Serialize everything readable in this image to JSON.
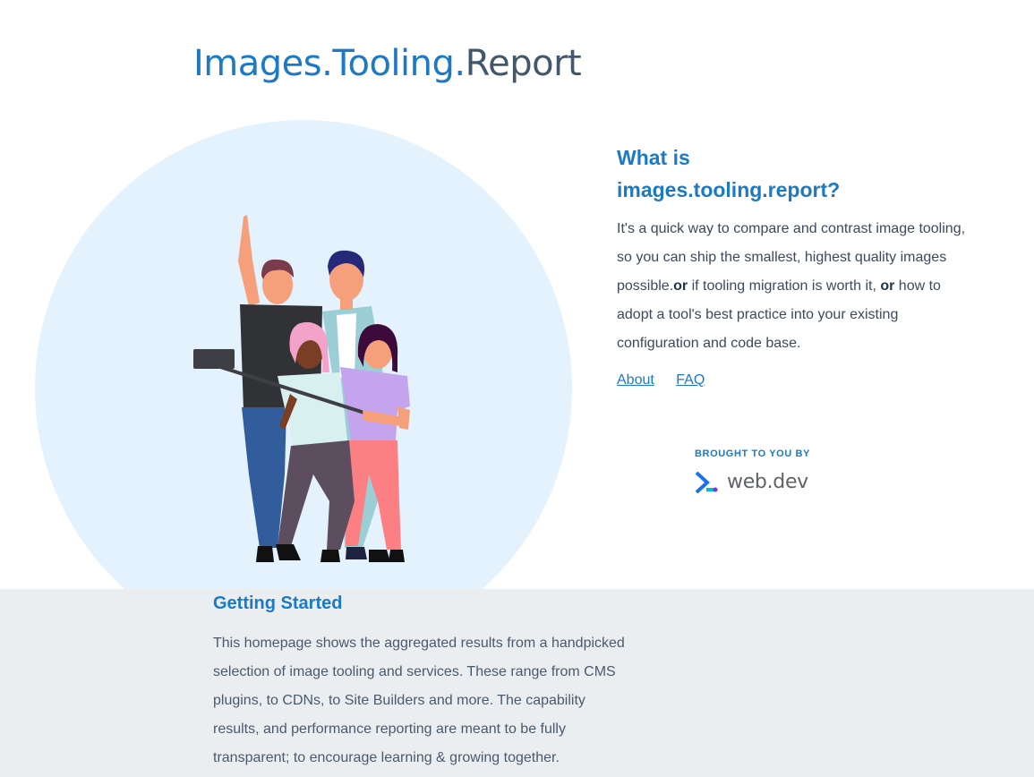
{
  "header": {
    "title_part1": "Images.",
    "title_part2": "Tooling.",
    "title_part3": "Report"
  },
  "intro": {
    "heading_line1": "What is",
    "heading_line2": "images.tooling.report?",
    "desc_1": "It's a quick way to compare and contrast image tooling, so you can ship the smallest, highest quality images possible.",
    "or_1": "or",
    "desc_2": " if tooling migration is worth it, ",
    "or_2": "or",
    "desc_3": " how to adopt a tool's best practice into your existing configuration and code base."
  },
  "nav": {
    "about": "About",
    "faq": "FAQ"
  },
  "sponsor": {
    "label": "BROUGHT TO YOU BY",
    "name": "web.dev",
    "icon": "web-dev-logo-icon"
  },
  "getting_started": {
    "heading": "Getting Started",
    "text": "This homepage shows the aggregated results from a handpicked selection of image tooling and services. These range from CMS plugins, to CDNs, to Site Builders and more. The capability results, and performance reporting are meant to be fully transparent; to encourage learning & growing together."
  },
  "hero": {
    "illustration": "group-selfie-illustration"
  },
  "colors": {
    "accent": "#1b79c6",
    "title_dark": "#42576c",
    "hero_bg": "#e3f2fd",
    "section_bg": "#ebeef1"
  }
}
